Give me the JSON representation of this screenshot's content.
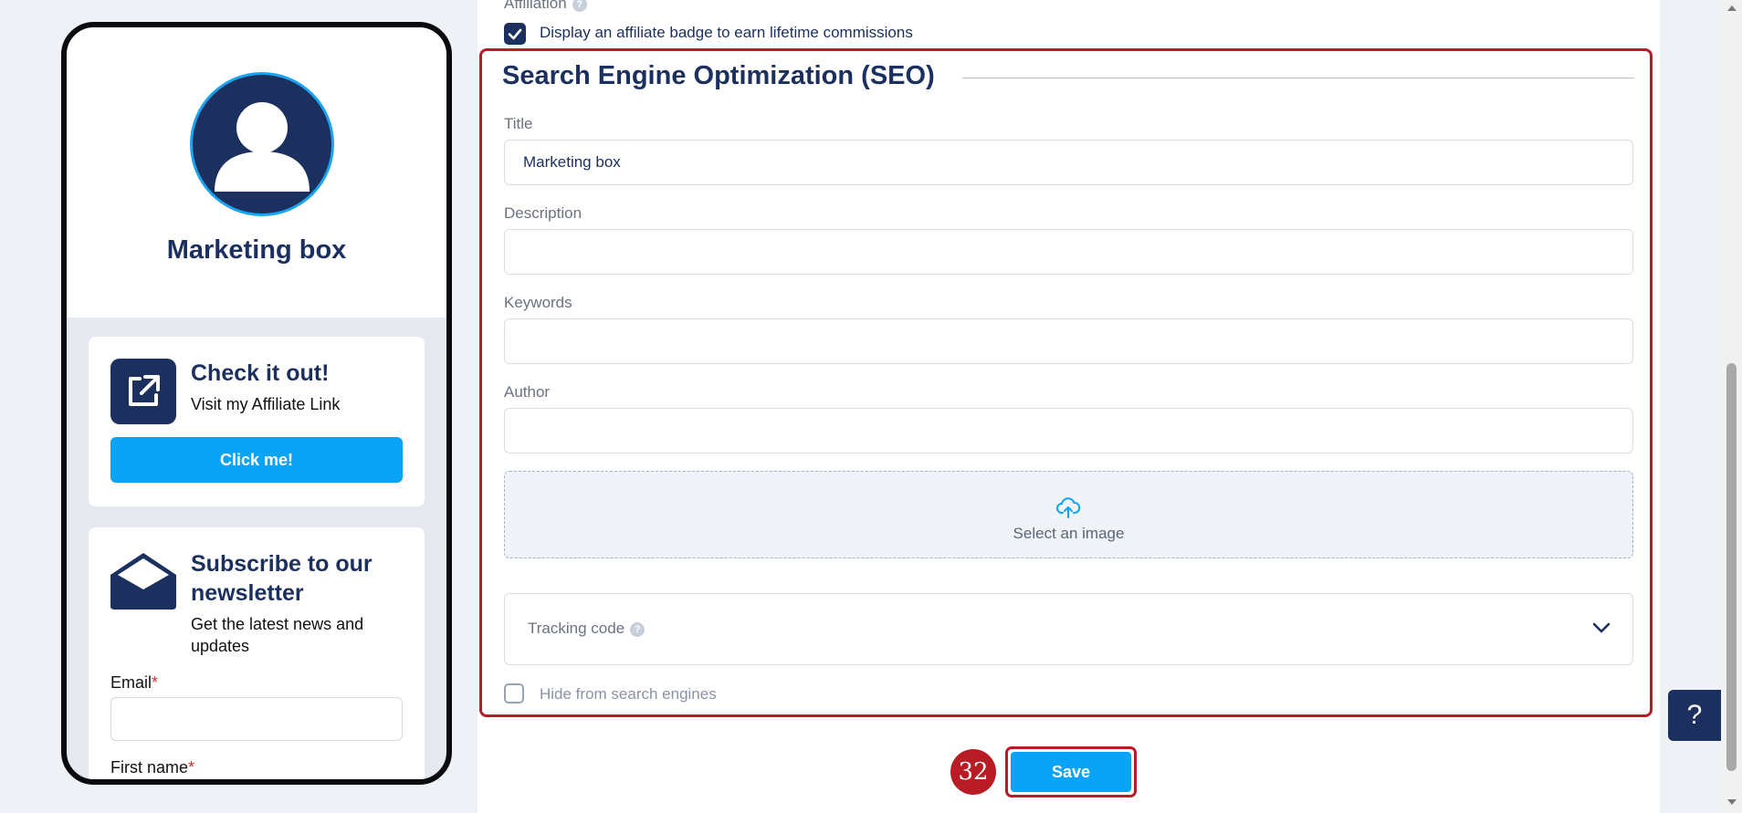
{
  "phone_preview": {
    "profile_name": "Marketing box",
    "affiliate_card": {
      "title": "Check it out!",
      "subtitle": "Visit my Affiliate Link",
      "button_label": "Click me!"
    },
    "newsletter_card": {
      "title": "Subscribe to our newsletter",
      "subtitle": "Get the latest news and updates",
      "email_label": "Email",
      "first_name_label": "First name",
      "required_mark": "*"
    }
  },
  "affiliation": {
    "label": "Affiliation",
    "help": "?",
    "checkbox_label": "Display an affiliate badge to earn lifetime commissions",
    "checked": true
  },
  "seo": {
    "heading": "Search Engine Optimization (SEO)",
    "title_label": "Title",
    "title_value": "Marketing box",
    "description_label": "Description",
    "description_value": "",
    "keywords_label": "Keywords",
    "keywords_value": "",
    "author_label": "Author",
    "author_value": "",
    "upload_label": "Select an image",
    "tracking_label": "Tracking code",
    "tracking_help": "?",
    "hide_label": "Hide from search engines",
    "hide_checked": false
  },
  "actions": {
    "step_number": "32",
    "save_label": "Save"
  },
  "help_button": "?",
  "colors": {
    "navy": "#1b305f",
    "accent_blue": "#0aa4f6",
    "highlight_red": "#b91c24"
  }
}
